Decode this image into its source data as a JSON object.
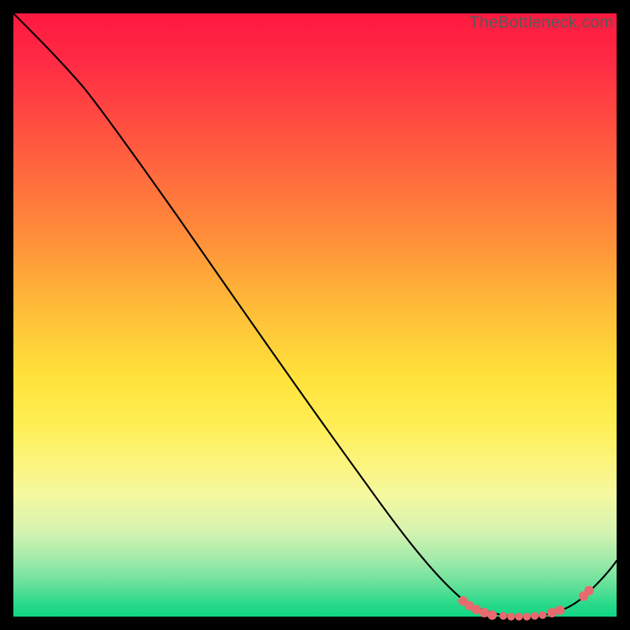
{
  "watermark": "TheBottleneck.com",
  "chart_data": {
    "type": "line",
    "title": "",
    "xlabel": "",
    "ylabel": "",
    "xlim": [
      0,
      100
    ],
    "ylim": [
      0,
      100
    ],
    "series": [
      {
        "name": "bottleneck-curve",
        "x": [
          0,
          4,
          8,
          12,
          16,
          20,
          24,
          28,
          32,
          36,
          40,
          44,
          48,
          52,
          56,
          60,
          64,
          68,
          72,
          76,
          80,
          84,
          88,
          92,
          96,
          100
        ],
        "y": [
          100,
          98,
          96,
          93,
          89,
          84,
          78,
          72,
          66,
          60,
          54,
          48,
          42,
          36,
          30,
          24,
          18,
          12,
          7,
          3,
          1,
          0,
          0,
          1,
          4,
          9
        ]
      }
    ],
    "marker_clusters": [
      {
        "name": "left-cluster",
        "x_range": [
          76,
          82
        ],
        "y": 0.5,
        "count": 5
      },
      {
        "name": "right-cluster",
        "x_range": [
          83,
          91
        ],
        "y": 0.2,
        "count": 6
      },
      {
        "name": "far-right",
        "x_range": [
          93,
          95
        ],
        "y": 1.5,
        "count": 2
      }
    ],
    "background": {
      "type": "vertical-gradient",
      "stops": [
        {
          "pos": 0.0,
          "color": "#ff1840"
        },
        {
          "pos": 0.5,
          "color": "#ffd33b"
        },
        {
          "pos": 0.8,
          "color": "#f4f8a0"
        },
        {
          "pos": 1.0,
          "color": "#0fd684"
        }
      ]
    }
  }
}
